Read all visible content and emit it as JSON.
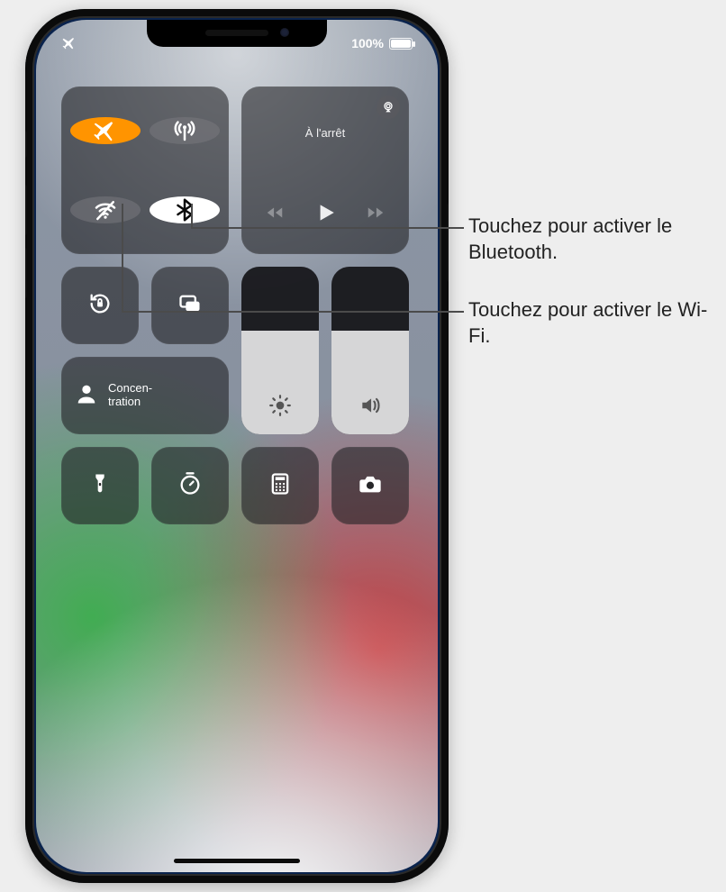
{
  "statusbar": {
    "battery_label": "100%"
  },
  "connectivity": {
    "airplane_icon": "airplane",
    "cellular_icon": "antenna",
    "wifi_icon": "wifi-off",
    "bluetooth_icon": "bluetooth"
  },
  "media": {
    "title": "À l'arrêt"
  },
  "focus": {
    "label": "Concen-\ntration"
  },
  "sliders": {
    "brightness_level": 0.62,
    "volume_level": 0.62
  },
  "callouts": {
    "bluetooth": "Touchez pour activer le Bluetooth.",
    "wifi": "Touchez pour activer le Wi-Fi."
  },
  "icons": {
    "orientation_lock": "orientation-lock",
    "screen_mirroring": "screen-mirroring",
    "flashlight": "flashlight",
    "timer": "timer",
    "calculator": "calculator",
    "camera": "camera",
    "airplay": "airplay"
  },
  "colors": {
    "airplane_on": "#ff9500",
    "bluetooth_on_bg": "#ffffff",
    "tile_bg": "rgba(30,30,33,0.58)"
  }
}
